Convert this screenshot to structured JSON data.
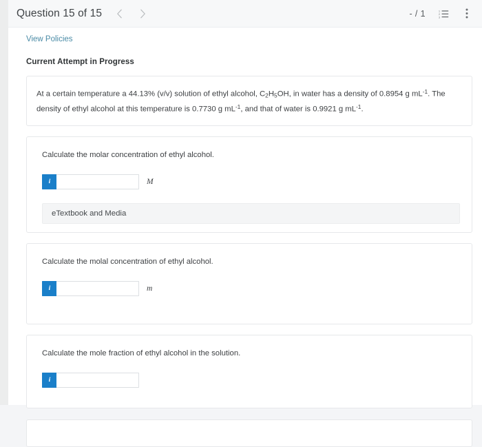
{
  "header": {
    "title": "Question 15 of 15",
    "prev_icon": "chevron-left-icon",
    "next_icon": "chevron-right-icon",
    "score": "- / 1",
    "list_icon": "numbered-list-icon",
    "menu_icon": "vertical-dots-icon"
  },
  "toolbar": {
    "view_policies_label": "View Policies",
    "attempt_status": "Current Attempt in Progress"
  },
  "prompt": {
    "line1_a": "At a certain temperature a 44.13% (v/v) solution of ethyl alcohol, C",
    "sub1": "2",
    "line1_b": "H",
    "sub2": "5",
    "line1_c": "OH, in water has a density of 0.8954 g mL",
    "sup1": "-1",
    "line1_d": ". The density of ethyl alcohol at this temperature is 0.7730 g mL",
    "sup2": "-1",
    "line1_e": ", and that of water is 0.9921 g mL",
    "sup3": "-1",
    "line1_f": "."
  },
  "questions": [
    {
      "label": "Calculate the molar concentration of ethyl alcohol.",
      "info_glyph": "i",
      "answer_value": "",
      "answer_placeholder": "",
      "unit": "M",
      "etextbook_label": "eTextbook and Media"
    },
    {
      "label": "Calculate the molal concentration of ethyl alcohol.",
      "info_glyph": "i",
      "answer_value": "",
      "answer_placeholder": "",
      "unit": "m"
    },
    {
      "label": "Calculate the mole fraction of ethyl alcohol in the solution.",
      "info_glyph": "i",
      "answer_value": "",
      "answer_placeholder": "",
      "unit": ""
    }
  ],
  "colors": {
    "accent_blue": "#1a7fc9",
    "link_teal": "#4a8ba6",
    "page_bg": "#f4f5f7",
    "card_border": "#e6e8ea"
  }
}
